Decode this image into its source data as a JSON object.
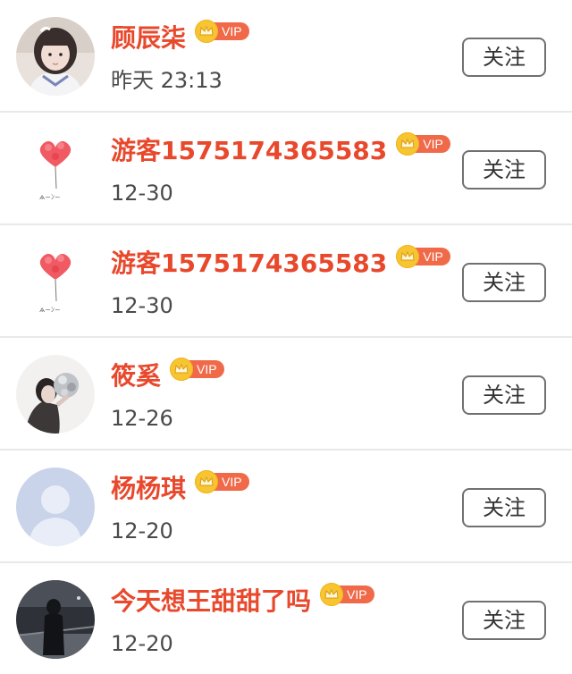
{
  "colors": {
    "name": "#e8482c",
    "vip_badge": "#f06a4a",
    "vip_crown": "#f7c531",
    "divider": "#e9e9e9",
    "button_border": "#707070"
  },
  "follow_label": "关注",
  "vip_label": "VIP",
  "users": [
    {
      "name": "顾辰柒",
      "time": "昨天 23:13",
      "avatar": "girl-portrait-avatar",
      "vip": true
    },
    {
      "name": "游客1575174365583",
      "time": "12-30",
      "avatar": "heart-balloon-avatar",
      "vip": true
    },
    {
      "name": "游客1575174365583",
      "time": "12-30",
      "avatar": "heart-balloon-avatar",
      "vip": true
    },
    {
      "name": "筱奚",
      "time": "12-26",
      "avatar": "girl-with-bouquet-avatar",
      "vip": true
    },
    {
      "name": "杨杨琪",
      "time": "12-20",
      "avatar": "default-silhouette-avatar",
      "vip": true
    },
    {
      "name": "今天想王甜甜了吗",
      "time": "12-20",
      "avatar": "dark-street-photo-avatar",
      "vip": true
    }
  ]
}
